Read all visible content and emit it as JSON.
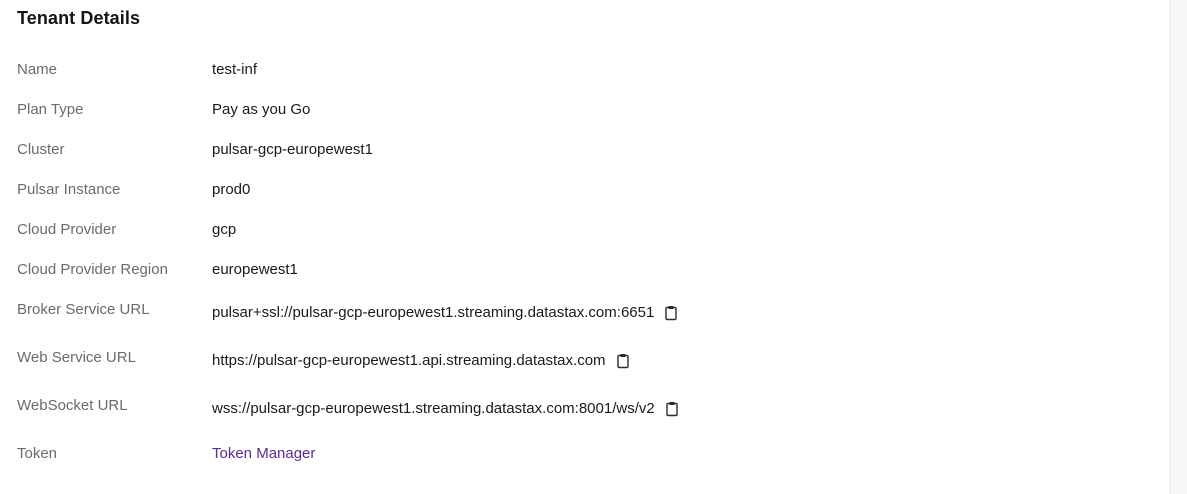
{
  "section": {
    "title": "Tenant Details"
  },
  "details": {
    "name": {
      "label": "Name",
      "value": "test-inf"
    },
    "plan_type": {
      "label": "Plan Type",
      "value": "Pay as you Go"
    },
    "cluster": {
      "label": "Cluster",
      "value": "pulsar-gcp-europewest1"
    },
    "pulsar_instance": {
      "label": "Pulsar Instance",
      "value": "prod0"
    },
    "cloud_provider": {
      "label": "Cloud Provider",
      "value": "gcp"
    },
    "cloud_provider_region": {
      "label": "Cloud Provider Region",
      "value": "europewest1"
    },
    "broker_service_url": {
      "label": "Broker Service URL",
      "value": "pulsar+ssl://pulsar-gcp-europewest1.streaming.datastax.com:6651",
      "icon": "clipboard-icon"
    },
    "web_service_url": {
      "label": "Web Service URL",
      "value": "https://pulsar-gcp-europewest1.api.streaming.datastax.com",
      "icon": "clipboard-icon"
    },
    "websocket_url": {
      "label": "WebSocket URL",
      "value": "wss://pulsar-gcp-europewest1.streaming.datastax.com:8001/ws/v2",
      "icon": "clipboard-icon"
    },
    "token": {
      "label": "Token",
      "link_text": "Token Manager"
    }
  },
  "colors": {
    "label": "#6b6b6b",
    "value": "#1a1a1a",
    "link": "#5b2a9e"
  }
}
